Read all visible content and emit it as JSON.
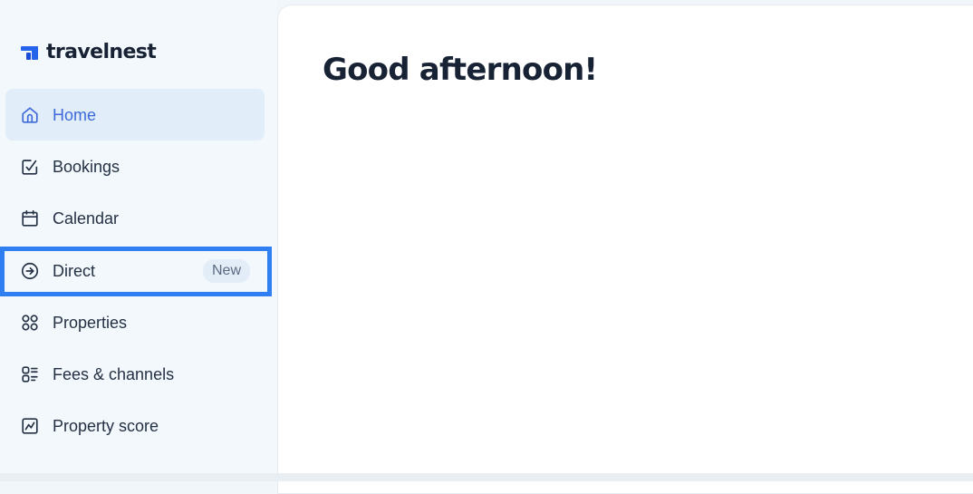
{
  "brand": {
    "name": "travelnest",
    "color": "#2563eb"
  },
  "sidebar": {
    "items": [
      {
        "label": "Home",
        "icon": "home-icon",
        "active": true
      },
      {
        "label": "Bookings",
        "icon": "calendar-check-icon"
      },
      {
        "label": "Calendar",
        "icon": "calendar-icon"
      },
      {
        "label": "Direct",
        "icon": "arrow-circle-right-icon",
        "badge": "New"
      },
      {
        "label": "Properties",
        "icon": "grid-circles-icon"
      },
      {
        "label": "Fees & channels",
        "icon": "list-icon"
      },
      {
        "label": "Property score",
        "icon": "chart-icon"
      }
    ]
  },
  "main": {
    "greeting": "Good afternoon!"
  },
  "colors": {
    "active_bg": "#e1edf9",
    "active_text": "#3d6ad8",
    "highlight": "#2f7ff2"
  }
}
